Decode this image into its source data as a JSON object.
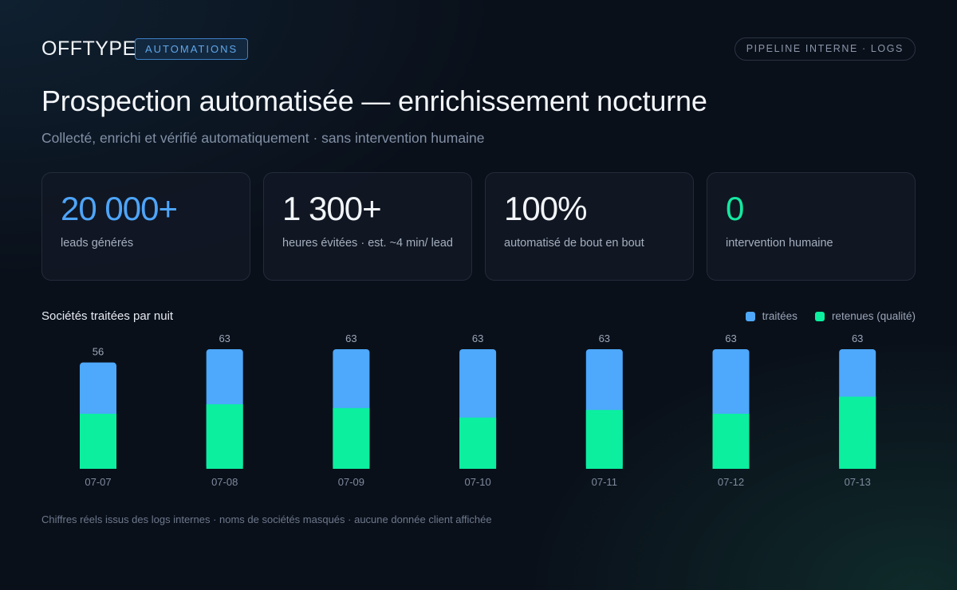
{
  "header": {
    "brand": "OFFTYPE",
    "tag": "AUTOMATIONS",
    "pill": "PIPELINE INTERNE · LOGS"
  },
  "title": "Prospection automatisée — enrichissement nocturne",
  "subtitle": "Collecté, enrichi et vérifié automatiquement · sans intervention humaine",
  "stats": [
    {
      "value": "20 000+",
      "label": "leads générés",
      "color": "#4ea5f9"
    },
    {
      "value": "1 300+",
      "label": "heures évitées · est. ~4 min/ lead",
      "color": "#f1f4f8"
    },
    {
      "value": "100%",
      "label": "automatisé de bout en bout",
      "color": "#f1f4f8"
    },
    {
      "value": "0",
      "label": "intervention humaine",
      "color": "#14e8a0"
    }
  ],
  "chart": {
    "title": "Sociétés traitées par nuit",
    "legend": {
      "processed": "traitées",
      "retained": "retenues (qualité)"
    }
  },
  "colors": {
    "processed": "#4ea8fb",
    "retained": "#0bef9f"
  },
  "chart_data": {
    "type": "bar",
    "title": "Sociétés traitées par nuit",
    "categories": [
      "07-07",
      "07-08",
      "07-09",
      "07-10",
      "07-11",
      "07-12",
      "07-13"
    ],
    "series": [
      {
        "name": "traitées",
        "values": [
          56,
          63,
          63,
          63,
          63,
          63,
          63
        ]
      },
      {
        "name": "retenues (qualité)",
        "values": [
          29,
          34,
          32,
          27,
          31,
          29,
          38
        ]
      }
    ],
    "data_labels": [
      "56",
      "63",
      "63",
      "63",
      "63",
      "63",
      "63"
    ],
    "ylim": [
      0,
      63
    ],
    "grid": false,
    "legend_position": "top-right"
  },
  "footer": "Chiffres réels issus des logs internes · noms de sociétés masqués · aucune donnée client affichée"
}
